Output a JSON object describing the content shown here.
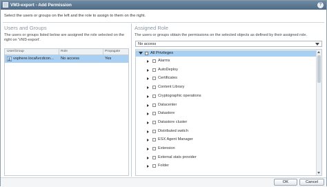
{
  "window": {
    "title": "VM3-export - Add Permission",
    "help_label": "?"
  },
  "instruction": "Select the users or groups on the left and the role to assign to them on the right.",
  "left": {
    "heading": "Users and Groups",
    "description": "The users or groups listed below are assigned the role selected on the right on 'VM3-export'.",
    "columns": [
      "User/Group",
      "Role",
      "Propagate"
    ],
    "rows": [
      {
        "user": "vsphere.local\\vcdcon...",
        "role": "No access",
        "propagate": "Yes"
      }
    ]
  },
  "right": {
    "heading": "Assigned Role",
    "description": "The users or groups obtain the permissions on the selected objects as defined by their assigned role.",
    "role_select": {
      "value": "No access"
    },
    "tree_root": "All Privileges",
    "tree_items": [
      "Alarms",
      "AutoDeploy",
      "Certificates",
      "Content Library",
      "Cryptographic operations",
      "Datacenter",
      "Datastore",
      "Datastore cluster",
      "Distributed switch",
      "ESX Agent Manager",
      "Extension",
      "External stats provider",
      "Folder"
    ]
  },
  "footer": {
    "ok_label": "OK",
    "cancel_label": "Cancel"
  }
}
